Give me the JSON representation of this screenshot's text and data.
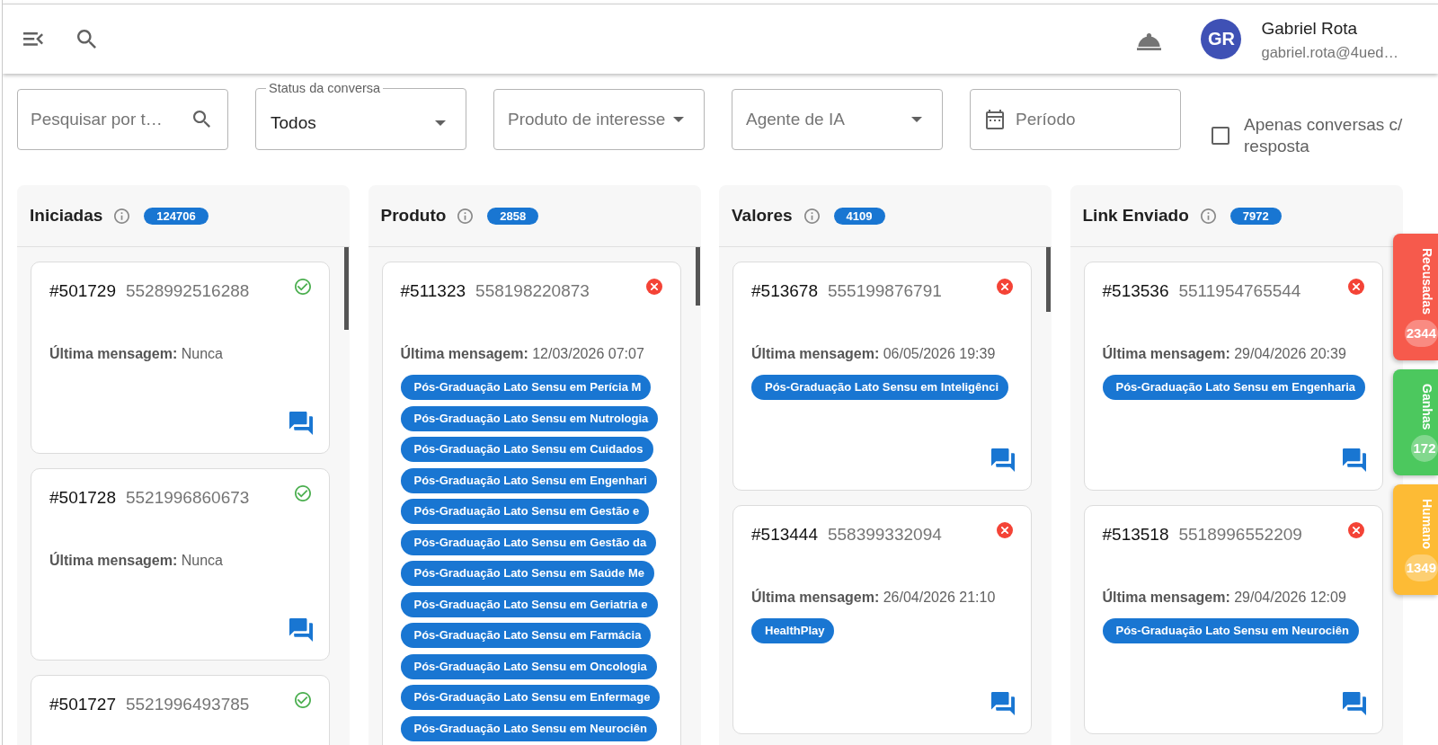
{
  "topbar": {
    "user": {
      "initials": "GR",
      "name": "Gabriel Rota",
      "email": "gabriel.rota@4ued…"
    }
  },
  "filters": [
    {
      "kind": "search",
      "placeholder": "Pesquisar por t…"
    },
    {
      "kind": "select",
      "label": "Status da conversa",
      "value": "Todos"
    },
    {
      "kind": "select",
      "placeholder": "Produto de interesse"
    },
    {
      "kind": "select",
      "placeholder": "Agente de IA"
    },
    {
      "kind": "date",
      "placeholder": "Período"
    }
  ],
  "only_replied": {
    "label": "Apenas conversas c/ resposta",
    "checked": false
  },
  "columns": [
    {
      "title": "Iniciadas",
      "count": "124706",
      "cards": [
        {
          "id": "#501729",
          "phone": "5528992516288",
          "accepted": true,
          "last_message": "**Última mensagem:** Nunca"
        },
        {
          "id": "#501728",
          "phone": "5521996860673",
          "accepted": true,
          "last_message": "**Última mensagem:** Nunca"
        },
        {
          "id": "#501727",
          "phone": "5521996493785",
          "accepted": true
        }
      ]
    },
    {
      "title": "Produto",
      "count": "2858",
      "cards": [
        {
          "id": "#511323",
          "phone": "558198220873",
          "accepted": false,
          "last_message": "**Última mensagem:** 12/03/2026 07:07",
          "tags": [
            "Pós-Graduação Lato Sensu em Perícia M",
            "Pós-Graduação Lato Sensu em Nutrologia",
            "Pós-Graduação Lato Sensu em Cuidados",
            "Pós-Graduação Lato Sensu em Engenhari",
            "Pós-Graduação Lato Sensu em Gestão e",
            "Pós-Graduação Lato Sensu em Gestão da",
            "Pós-Graduação Lato Sensu em Saúde Me",
            "Pós-Graduação Lato Sensu em Geriatria e",
            "Pós-Graduação Lato Sensu em Farmácia",
            "Pós-Graduação Lato Sensu em Oncologia",
            "Pós-Graduação Lato Sensu em Enfermage",
            "Pós-Graduação Lato Sensu em Neurociên"
          ]
        }
      ]
    },
    {
      "title": "Valores",
      "count": "4109",
      "cards": [
        {
          "id": "#513678",
          "phone": "555199876791",
          "accepted": false,
          "last_message": "**Última mensagem:** 06/05/2026 19:39",
          "tags": [
            "Pós-Graduação Lato Sensu em Inteligênci"
          ]
        },
        {
          "id": "#513444",
          "phone": "558399332094",
          "accepted": false,
          "last_message": "**Última mensagem:** 26/04/2026 21:10",
          "tags": [
            "HealthPlay"
          ]
        }
      ]
    },
    {
      "title": "Link Enviado",
      "count": "7972",
      "cards": [
        {
          "id": "#513536",
          "phone": "5511954765544",
          "accepted": false,
          "last_message": "**Última mensagem:** 29/04/2026 20:39",
          "tags": [
            "Pós-Graduação Lato Sensu em Engenharia"
          ]
        },
        {
          "id": "#513518",
          "phone": "5518996552209",
          "accepted": false,
          "last_message": "**Última mensagem:** 29/04/2026 12:09",
          "tags": [
            "Pós-Graduação Lato Sensu em Neurociên"
          ]
        }
      ]
    }
  ],
  "side_tabs": [
    {
      "label": "Recusadas",
      "count": "2344",
      "color": "#f65a4c"
    },
    {
      "label": "Ganhas",
      "count": "172",
      "color": "#4cc85e"
    },
    {
      "label": "Humano",
      "count": "1349",
      "color": "#fdbb35"
    }
  ]
}
